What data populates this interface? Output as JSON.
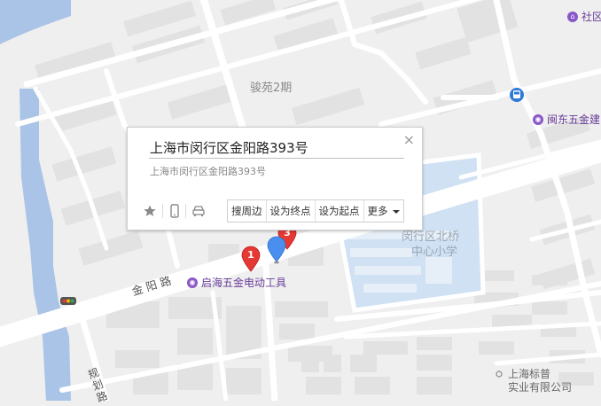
{
  "labels": {
    "area_junyuan": "骏苑2期",
    "school": "闵行区北桥中心小学",
    "school_line1": "闵行区北桥",
    "school_line2": "中心小学",
    "company_line1": "上海标普",
    "company_line2": "实业有限公司",
    "road_jinyang": "金阳路",
    "road_guihua": "规划路"
  },
  "pois": [
    {
      "label": "社区",
      "icon": "community-icon"
    },
    {
      "label": "闽东五金建",
      "icon": "store-icon"
    },
    {
      "label": "启海五金电动工具",
      "icon": "store-icon"
    }
  ],
  "markers": [
    {
      "label": "1",
      "color": "#e53935"
    },
    {
      "label": "3",
      "color": "#e53935"
    }
  ],
  "current_pin_color": "#4a8ff0",
  "popup": {
    "title": "上海市闵行区金阳路393号",
    "address": "上海市闵行区金阳路393号",
    "close_symbol": "×",
    "icons": [
      "star-icon",
      "phone-icon",
      "car-icon"
    ],
    "actions": {
      "search_nearby": "搜周边",
      "set_destination": "设为终点",
      "set_origin": "设为起点",
      "more": "更多"
    }
  },
  "colors": {
    "background": "#efefef",
    "water": "#a9c4e7",
    "road": "#ffffff",
    "block": "#e2e2e2",
    "school_area": "#cfe1f3",
    "poi": "#8a56c8"
  }
}
